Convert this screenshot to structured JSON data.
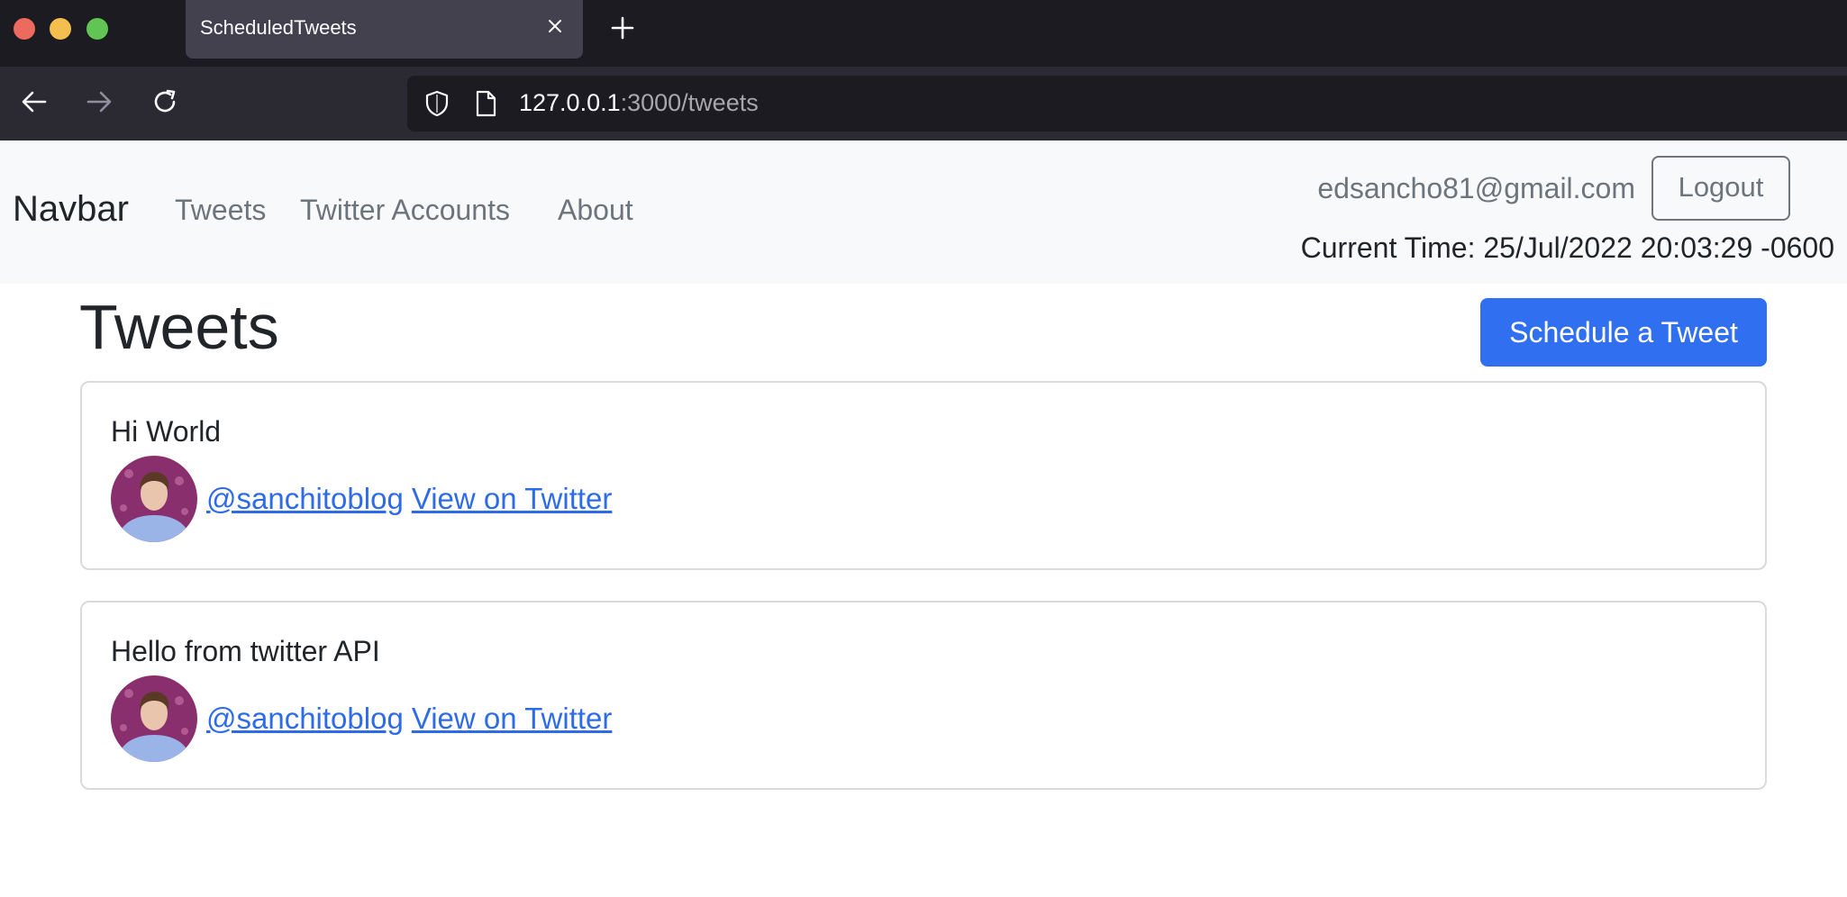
{
  "browser": {
    "tab_title": "ScheduledTweets",
    "url_host": "127.0.0.1",
    "url_rest": ":3000/tweets"
  },
  "navbar": {
    "brand": "Navbar",
    "links": [
      "Tweets",
      "Twitter Accounts",
      "About"
    ],
    "user_email": "edsancho81@gmail.com",
    "logout_label": "Logout",
    "current_time": "Current Time: 25/Jul/2022 20:03:29 -0600"
  },
  "main": {
    "title": "Tweets",
    "schedule_label": "Schedule a Tweet",
    "tweets": [
      {
        "body": "Hi World",
        "handle": "@sanchitoblog",
        "view_label": "View on Twitter"
      },
      {
        "body": "Hello from twitter API",
        "handle": "@sanchitoblog",
        "view_label": "View on Twitter"
      }
    ]
  },
  "colors": {
    "primary": "#2f6ff0",
    "link": "#2e6be8",
    "navbar_bg": "#f8f9fa",
    "chrome_bg": "#1c1b22"
  }
}
